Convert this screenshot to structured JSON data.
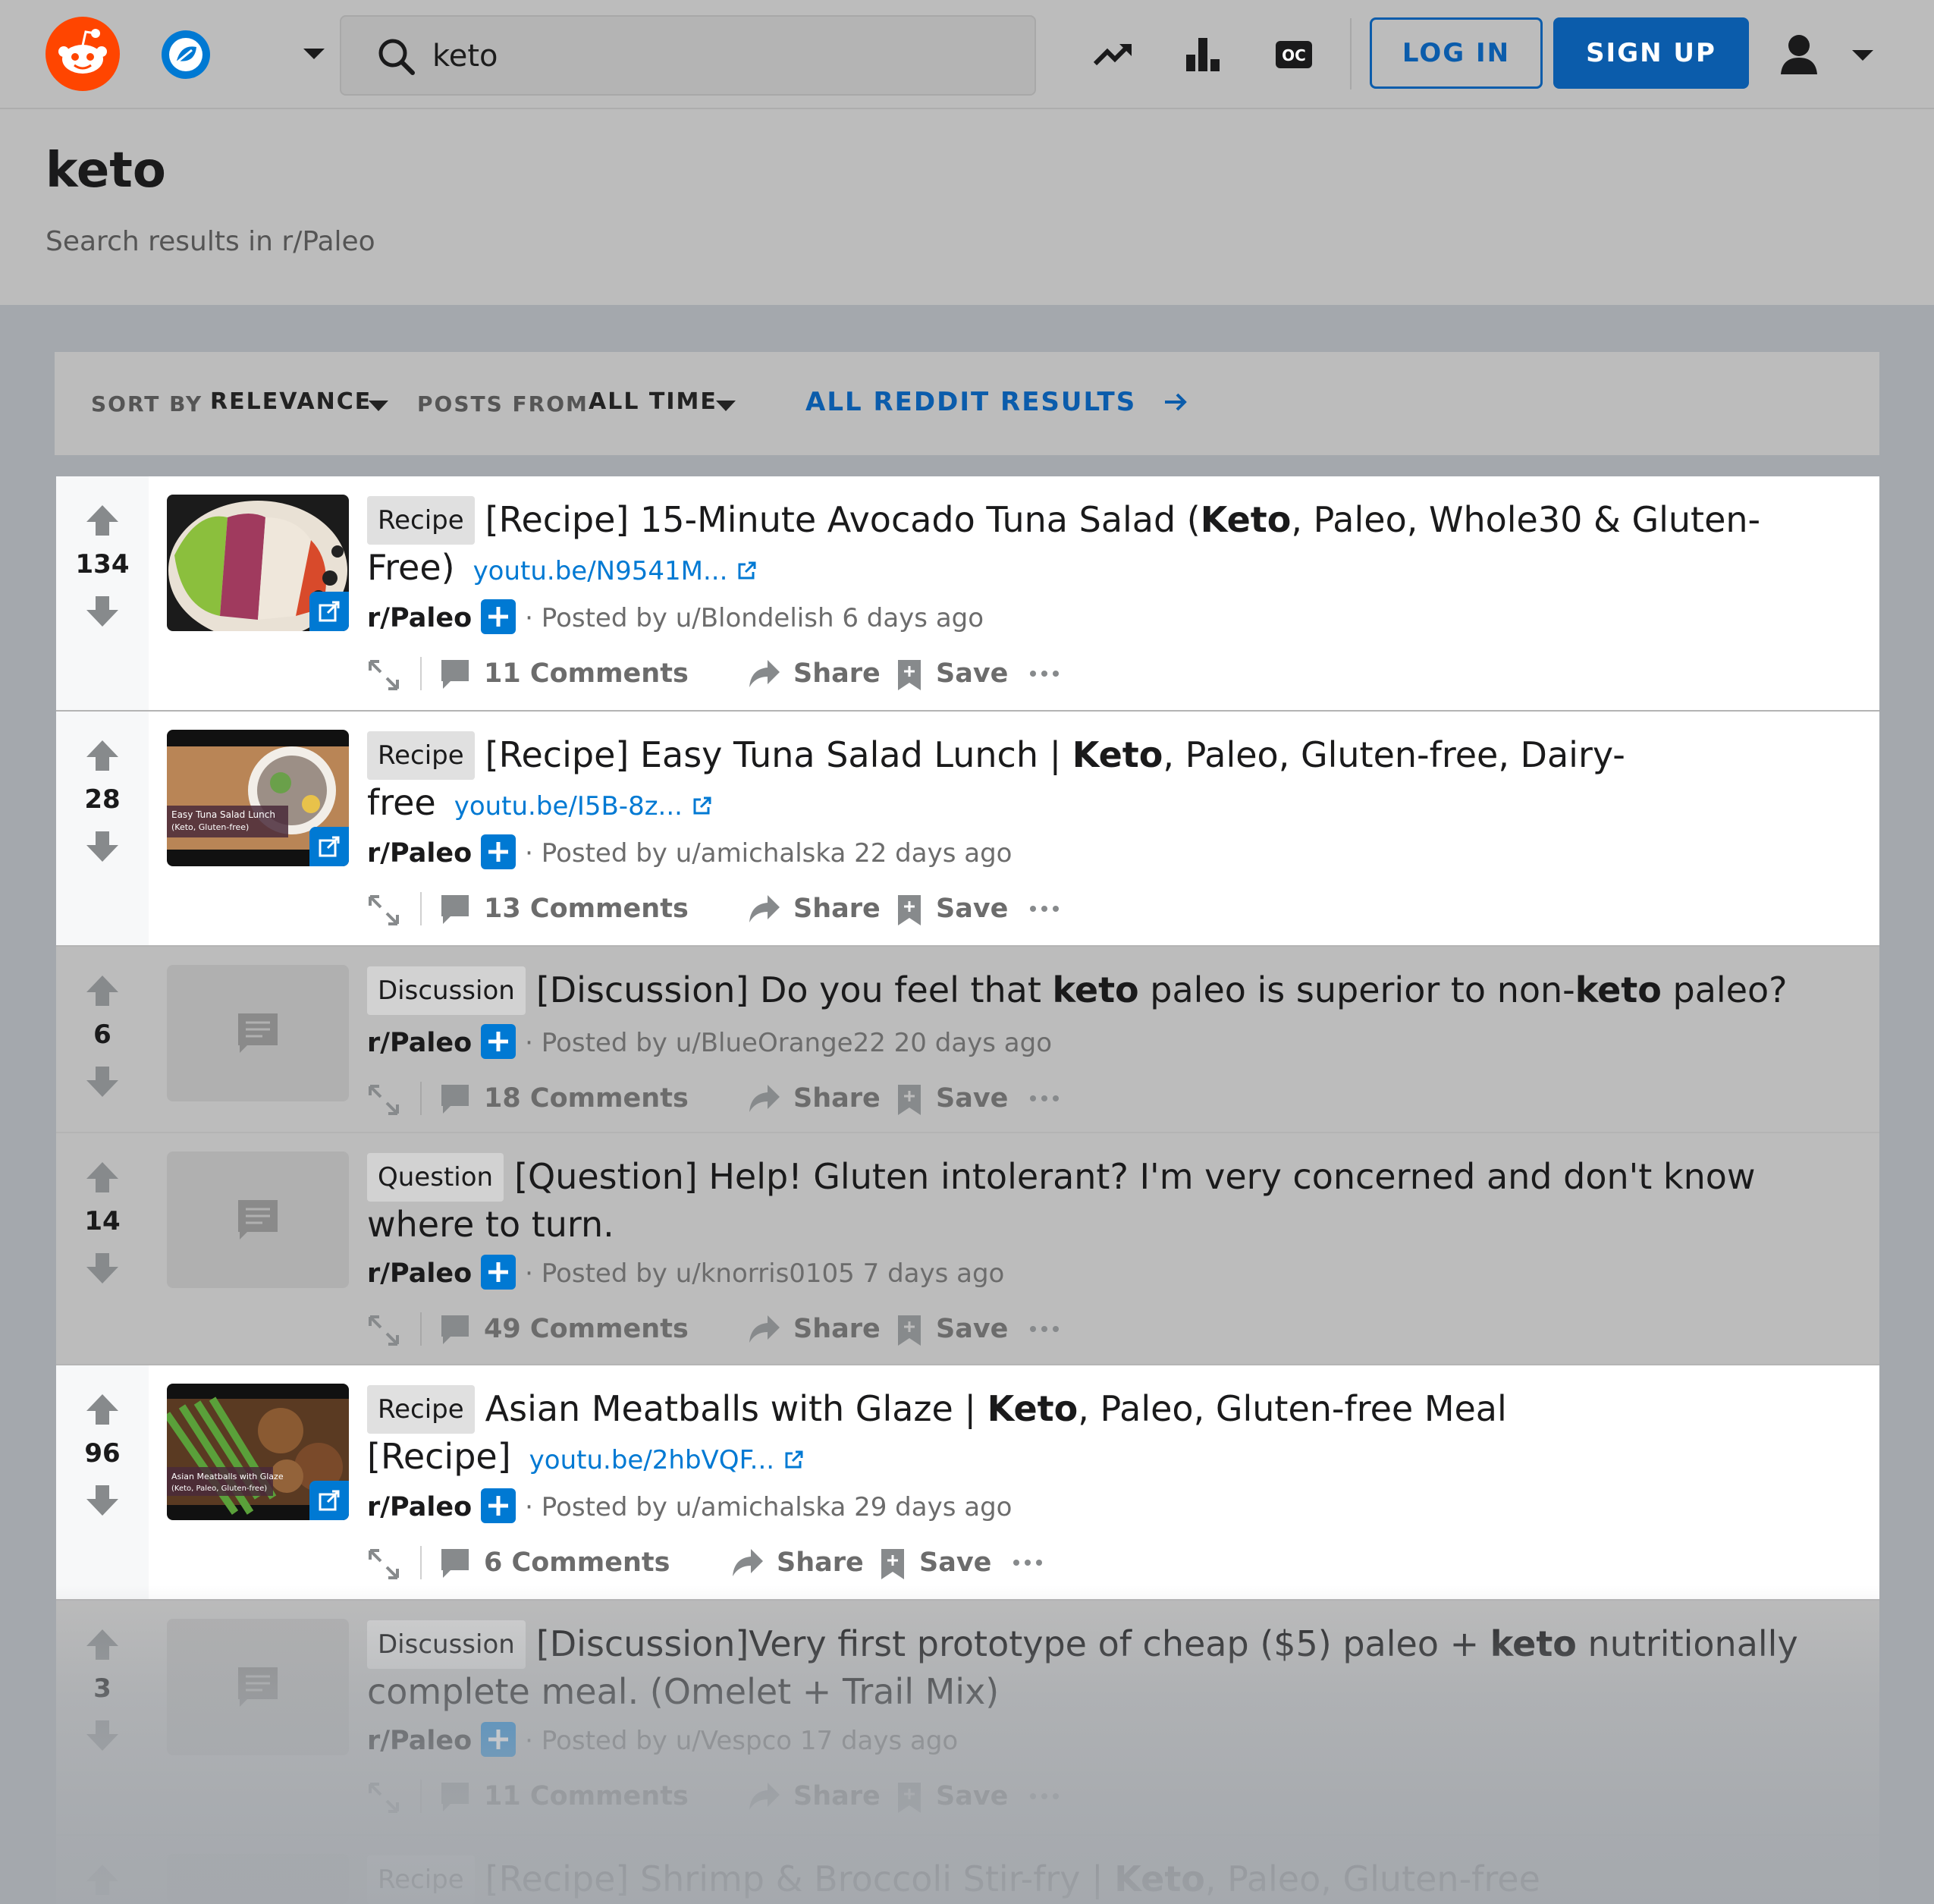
{
  "header": {
    "search_value": "keto",
    "login_label": "LOG IN",
    "signup_label": "SIGN UP",
    "icons": {
      "logo": "reddit-logo-icon",
      "community": "community-icon",
      "popular": "trending-up-icon",
      "all": "leaderboard-icon",
      "oc": "oc-icon",
      "user": "user-icon"
    },
    "oc_text": "OC"
  },
  "search_header": {
    "title": "keto",
    "subtitle": "Search results in r/Paleo"
  },
  "filters": {
    "sort_label": "SORT BY",
    "sort_value": "RELEVANCE",
    "posts_from_label": "POSTS FROM",
    "posts_from_value": "ALL TIME",
    "all_results_link": "ALL REDDIT RESULTS"
  },
  "colors": {
    "accent": "#0079d3",
    "brand": "#ff4500",
    "button_blue": "#0b5cab"
  },
  "posts": [
    {
      "votes": "134",
      "flair": "Recipe",
      "title_a": "[Recipe] 15-Minute Avocado Tuna Salad (",
      "title_bold1": "Keto",
      "title_b": ", Paleo, Whole30 & Gluten-Free)",
      "domain": "youtu.be/N9541M...",
      "subreddit": "r/Paleo",
      "posted_by": "· Posted by u/Blondelish 6 days ago",
      "comments": "11 Comments",
      "share": "Share",
      "save": "Save"
    },
    {
      "votes": "28",
      "flair": "Recipe",
      "title_a": "[Recipe] Easy Tuna Salad Lunch | ",
      "title_bold1": "Keto",
      "title_b": ", Paleo, Gluten-free, Dairy-free",
      "domain": "youtu.be/I5B-8z...",
      "thumb_caption_1": "Easy Tuna Salad Lunch",
      "thumb_caption_2": "(Keto, Gluten-free)",
      "subreddit": "r/Paleo",
      "posted_by": "· Posted by u/amichalska 22 days ago",
      "comments": "13 Comments",
      "share": "Share",
      "save": "Save"
    },
    {
      "votes": "6",
      "flair": "Discussion",
      "title_a": "[Discussion] Do you feel that ",
      "title_bold1": "keto",
      "title_b": " paleo is superior to non-",
      "title_bold2": "keto",
      "title_c": " paleo?",
      "subreddit": "r/Paleo",
      "posted_by": "· Posted by u/BlueOrange22 20 days ago",
      "comments": "18 Comments",
      "share": "Share",
      "save": "Save"
    },
    {
      "votes": "14",
      "flair": "Question",
      "title_a": "[Question] Help! Gluten intolerant? I'm very concerned and don't know where to turn.",
      "subreddit": "r/Paleo",
      "posted_by": "· Posted by u/knorris0105 7 days ago",
      "comments": "49 Comments",
      "share": "Share",
      "save": "Save"
    },
    {
      "votes": "96",
      "flair": "Recipe",
      "title_a": "Asian Meatballs with Glaze | ",
      "title_bold1": "Keto",
      "title_b": ", Paleo, Gluten-free Meal [Recipe]",
      "domain": "youtu.be/2hbVQF...",
      "thumb_caption_1": "Asian Meatballs with Glaze",
      "thumb_caption_2": "(Keto, Paleo, Gluten-free)",
      "subreddit": "r/Paleo",
      "posted_by": "· Posted by u/amichalska 29 days ago",
      "comments": "6 Comments",
      "share": "Share",
      "save": "Save"
    },
    {
      "votes": "3",
      "flair": "Discussion",
      "title_a": "[Discussion]Very first prototype of cheap ($5) paleo + ",
      "title_bold1": "keto",
      "title_b": " nutritionally complete meal. (Omelet + Trail Mix)",
      "subreddit": "r/Paleo",
      "posted_by": "· Posted by u/Vespco 17 days ago",
      "comments": "11 Comments",
      "share": "Share",
      "save": "Save"
    },
    {
      "flair": "Recipe",
      "title_a": "[Recipe] Shrimp & Broccoli Stir-fry | ",
      "title_bold1": "Keto",
      "title_b": ", Paleo, Gluten-free"
    }
  ]
}
